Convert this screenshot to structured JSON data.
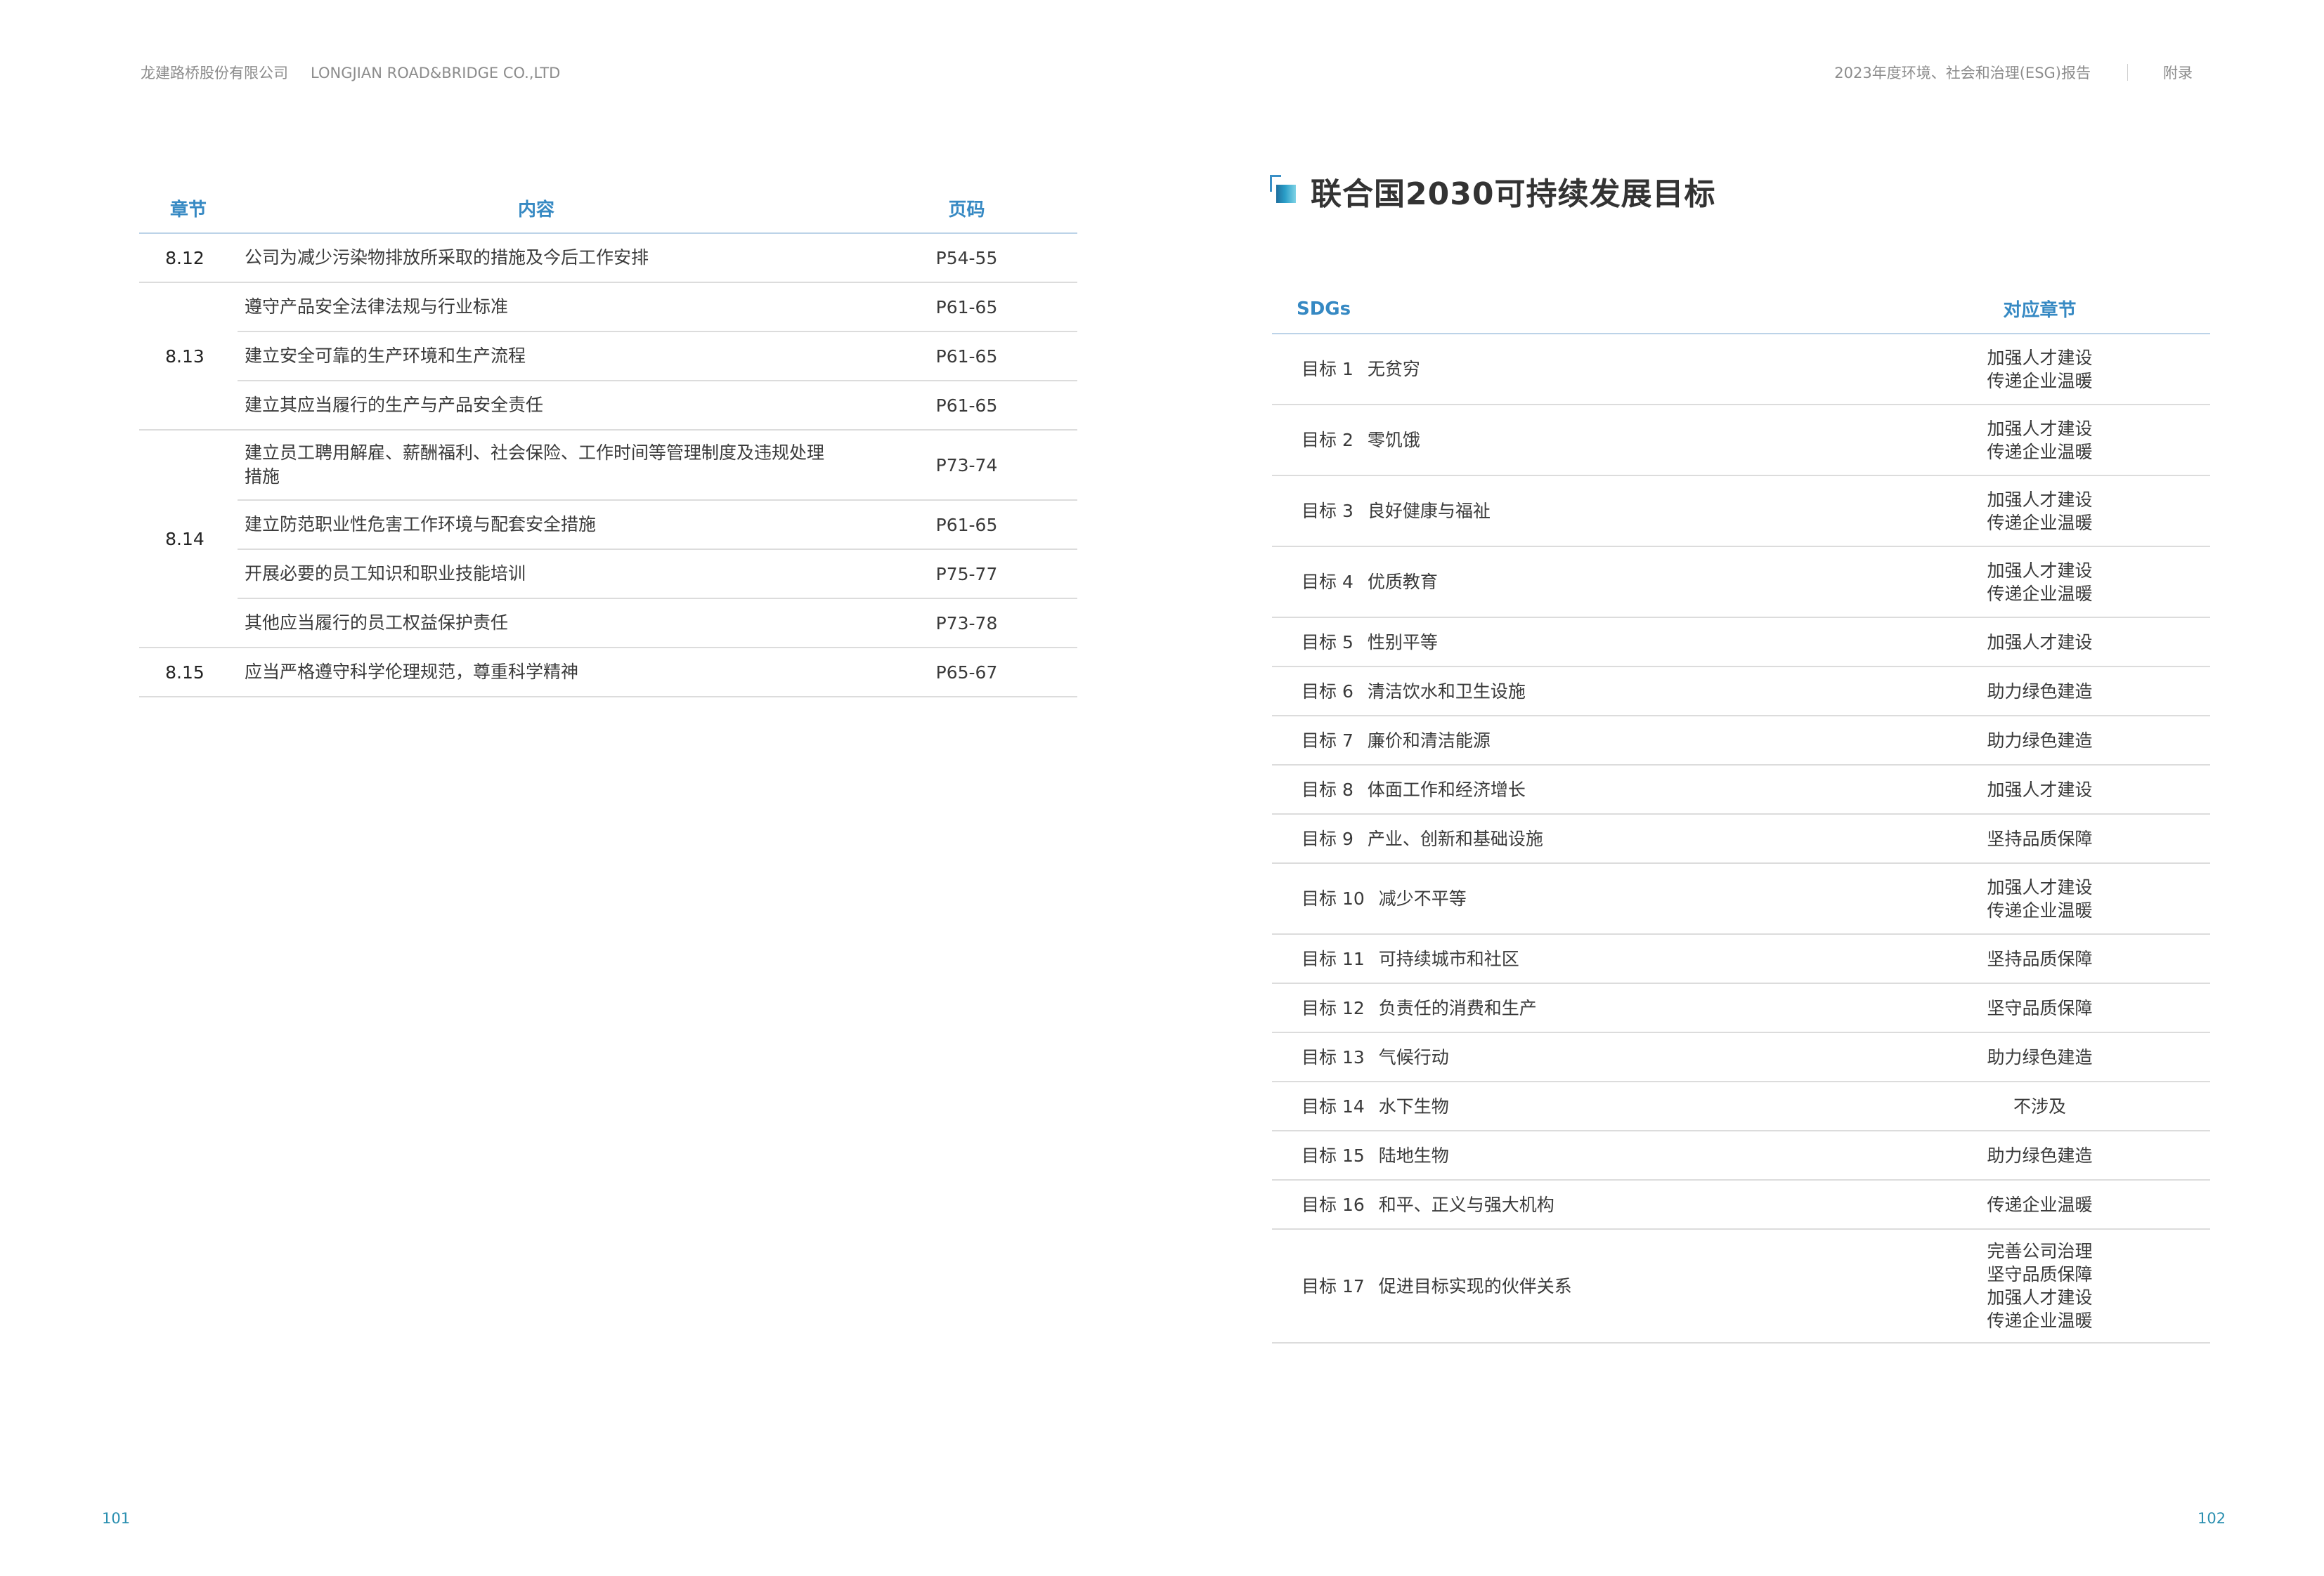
{
  "header": {
    "company_cn": "龙建路桥股份有限公司",
    "company_en": "LONGJIAN ROAD&BRIDGE CO.,LTD",
    "report_title": "2023年度环境、社会和治理(ESG)报告",
    "section": "附录"
  },
  "pages": {
    "left": "101",
    "right": "102"
  },
  "left_table": {
    "headers": {
      "chapter": "章节",
      "content": "内容",
      "page": "页码"
    },
    "rows": [
      {
        "chapter": "8.12",
        "content": "公司为减少污染物排放所采取的措施及今后工作安排",
        "page": "P54-55"
      },
      {
        "chapter": "8.13",
        "content": "遵守产品安全法律法规与行业标准",
        "page": "P61-65"
      },
      {
        "chapter": "",
        "content": "建立安全可靠的生产环境和生产流程",
        "page": "P61-65"
      },
      {
        "chapter": "",
        "content": "建立其应当履行的生产与产品安全责任",
        "page": "P61-65"
      },
      {
        "chapter": "8.14",
        "content": "建立员工聘用解雇、薪酬福利、社会保险、工作时间等管理制度及违规处理措施",
        "page": "P73-74"
      },
      {
        "chapter": "",
        "content": "建立防范职业性危害工作环境与配套安全措施",
        "page": "P61-65"
      },
      {
        "chapter": "",
        "content": "开展必要的员工知识和职业技能培训",
        "page": "P75-77"
      },
      {
        "chapter": "",
        "content": "其他应当履行的员工权益保护责任",
        "page": "P73-78"
      },
      {
        "chapter": "8.15",
        "content": "应当严格遵守科学伦理规范，尊重科学精神",
        "page": "P65-67"
      }
    ]
  },
  "section_title": "联合国2030可持续发展目标",
  "sdg_table": {
    "headers": {
      "sdg": "SDGs",
      "chapter": "对应章节"
    },
    "rows": [
      {
        "num": "目标 1",
        "name": "无贫穷",
        "chapters": [
          "加强人才建设",
          "传递企业温暖"
        ]
      },
      {
        "num": "目标 2",
        "name": "零饥饿",
        "chapters": [
          "加强人才建设",
          "传递企业温暖"
        ]
      },
      {
        "num": "目标 3",
        "name": "良好健康与福祉",
        "chapters": [
          "加强人才建设",
          "传递企业温暖"
        ]
      },
      {
        "num": "目标 4",
        "name": "优质教育",
        "chapters": [
          "加强人才建设",
          "传递企业温暖"
        ]
      },
      {
        "num": "目标 5",
        "name": "性别平等",
        "chapters": [
          "加强人才建设"
        ]
      },
      {
        "num": "目标 6",
        "name": "清洁饮水和卫生设施",
        "chapters": [
          "助力绿色建造"
        ]
      },
      {
        "num": "目标 7",
        "name": "廉价和清洁能源",
        "chapters": [
          "助力绿色建造"
        ]
      },
      {
        "num": "目标 8",
        "name": "体面工作和经济增长",
        "chapters": [
          "加强人才建设"
        ]
      },
      {
        "num": "目标 9",
        "name": "产业、创新和基础设施",
        "chapters": [
          "坚持品质保障"
        ]
      },
      {
        "num": "目标 10",
        "name": "减少不平等",
        "chapters": [
          "加强人才建设",
          "传递企业温暖"
        ]
      },
      {
        "num": "目标 11",
        "name": "可持续城市和社区",
        "chapters": [
          "坚持品质保障"
        ]
      },
      {
        "num": "目标 12",
        "name": "负责任的消费和生产",
        "chapters": [
          "坚守品质保障"
        ]
      },
      {
        "num": "目标 13",
        "name": "气候行动",
        "chapters": [
          "助力绿色建造"
        ]
      },
      {
        "num": "目标 14",
        "name": "水下生物",
        "chapters": [
          "不涉及"
        ]
      },
      {
        "num": "目标 15",
        "name": "陆地生物",
        "chapters": [
          "助力绿色建造"
        ]
      },
      {
        "num": "目标 16",
        "name": "和平、正义与强大机构",
        "chapters": [
          "传递企业温暖"
        ]
      },
      {
        "num": "目标 17",
        "name": "促进目标实现的伙伴关系",
        "chapters": [
          "完善公司治理",
          "坚守品质保障",
          "加强人才建设",
          "传递企业温暖"
        ]
      }
    ]
  }
}
